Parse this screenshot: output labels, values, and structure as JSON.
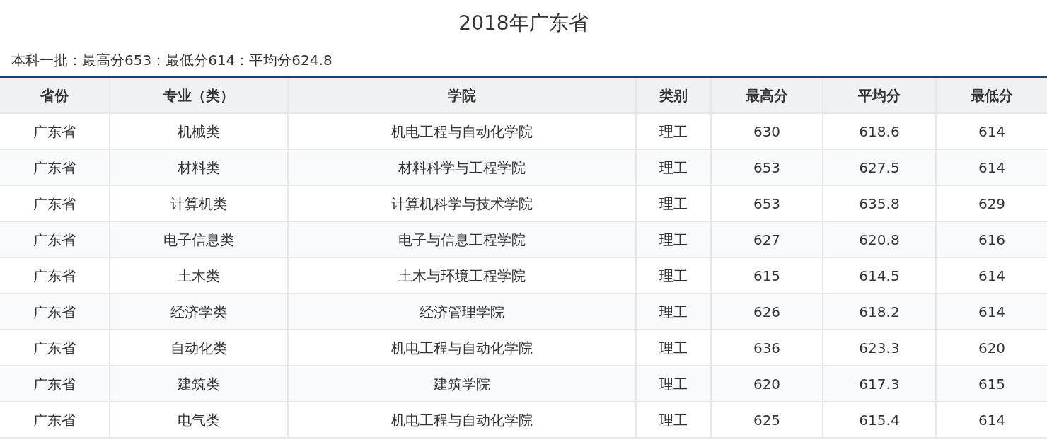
{
  "title": "2018年广东省",
  "summary": "本科一批：最高分653：最低分614：平均分624.8",
  "table": {
    "columns": [
      "省份",
      "专业（类）",
      "学院",
      "类别",
      "最高分",
      "平均分",
      "最低分"
    ],
    "rows": [
      [
        "广东省",
        "机械类",
        "机电工程与自动化学院",
        "理工",
        "630",
        "618.6",
        "614"
      ],
      [
        "广东省",
        "材料类",
        "材料科学与工程学院",
        "理工",
        "653",
        "627.5",
        "614"
      ],
      [
        "广东省",
        "计算机类",
        "计算机科学与技术学院",
        "理工",
        "653",
        "635.8",
        "629"
      ],
      [
        "广东省",
        "电子信息类",
        "电子与信息工程学院",
        "理工",
        "627",
        "620.8",
        "616"
      ],
      [
        "广东省",
        "土木类",
        "土木与环境工程学院",
        "理工",
        "615",
        "614.5",
        "614"
      ],
      [
        "广东省",
        "经济学类",
        "经济管理学院",
        "理工",
        "626",
        "618.2",
        "614"
      ],
      [
        "广东省",
        "自动化类",
        "机电工程与自动化学院",
        "理工",
        "636",
        "623.3",
        "620"
      ],
      [
        "广东省",
        "建筑类",
        "建筑学院",
        "理工",
        "620",
        "617.3",
        "615"
      ],
      [
        "广东省",
        "电气类",
        "机电工程与自动化学院",
        "理工",
        "625",
        "615.4",
        "614"
      ]
    ]
  }
}
